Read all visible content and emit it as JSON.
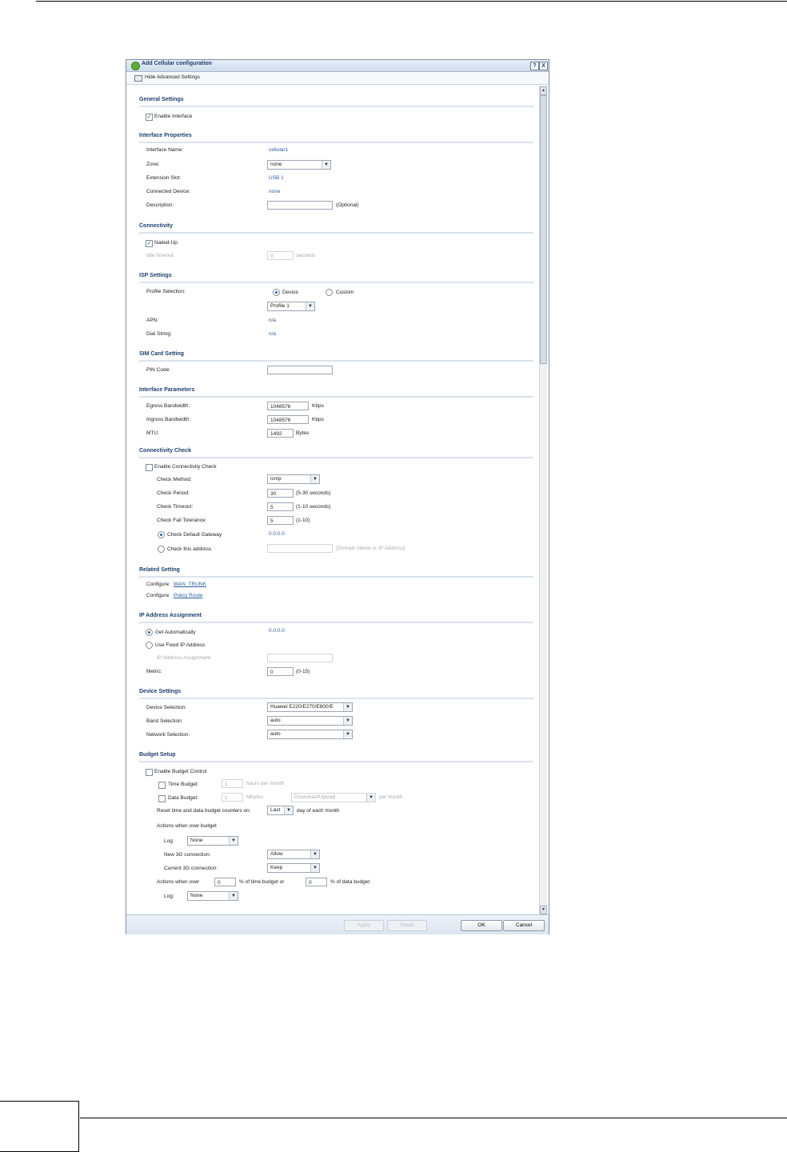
{
  "dialog": {
    "title": "Add Cellular configuration",
    "help_label": "?",
    "close_label": "X",
    "advanced_label": "Hide Advanced Settings"
  },
  "general": {
    "heading": "General Settings",
    "enable_interface": "Enable Interface"
  },
  "iface_props": {
    "heading": "Interface Properties",
    "name_label": "Interface Name:",
    "name_value": "cellular1",
    "zone_label": "Zone:",
    "zone_value": "none",
    "slot_label": "Extension Slot:",
    "slot_value": "USB 1",
    "device_label": "Connected Device:",
    "device_value": "none",
    "desc_label": "Description:",
    "desc_value": "",
    "desc_hint": "(Optional)"
  },
  "connectivity": {
    "heading": "Connectivity",
    "nailed_up": "Nailed-Up",
    "idle_label": "Idle timeout:",
    "idle_value": "0",
    "idle_unit": "seconds"
  },
  "isp": {
    "heading": "ISP Settings",
    "profile_label": "Profile Selection:",
    "opt_device": "Device",
    "opt_custom": "Custom",
    "profile_value": "Profile 1",
    "apn_label": "APN:",
    "apn_value": "n/a",
    "dial_label": "Dial String:",
    "dial_value": "n/a"
  },
  "sim": {
    "heading": "SIM Card Setting",
    "pin_label": "PIN Code:",
    "pin_value": ""
  },
  "params": {
    "heading": "Interface Parameters",
    "egress_label": "Egress Bandwidth:",
    "egress_value": "1048576",
    "egress_unit": "Kbps",
    "ingress_label": "Ingress Bandwidth:",
    "ingress_value": "1048576",
    "ingress_unit": "Kbps",
    "mtu_label": "MTU:",
    "mtu_value": "1492",
    "mtu_unit": "Bytes"
  },
  "check": {
    "heading": "Connectivity Check",
    "enable": "Enable Connectivity Check",
    "method_label": "Check Method:",
    "method_value": "icmp",
    "period_label": "Check Period:",
    "period_value": "30",
    "period_hint": "(5-30 seconds)",
    "timeout_label": "Check Timeout:",
    "timeout_value": "5",
    "timeout_hint": "(1-10 seconds)",
    "fail_label": "Check Fail Tolerance:",
    "fail_value": "5",
    "fail_hint": "(1-10)",
    "gw_label": "Check Default Gateway",
    "gw_value": "0.0.0.0",
    "addr_label": "Check this address",
    "addr_value": "",
    "addr_hint": "(Domain Name or IP Address)"
  },
  "related": {
    "heading": "Related Setting",
    "configure": "Configure",
    "wan_trunk": "WAN_TRUNK",
    "policy_route": "Policy Route"
  },
  "ip": {
    "heading": "IP Address Assignment",
    "auto": "Get Automatically",
    "auto_value": "0.0.0.0",
    "fixed": "Use Fixed IP Address",
    "assign_label": "IP Address Assignment:",
    "assign_value": "",
    "metric_label": "Metric:",
    "metric_value": "0",
    "metric_hint": "(0-15)"
  },
  "device": {
    "heading": "Device Settings",
    "device_label": "Device Selection:",
    "device_value": "Huawei E220/E270/E800/E",
    "band_label": "Band Selection:",
    "band_value": "auto",
    "network_label": "Network Selection:",
    "network_value": "auto"
  },
  "budget": {
    "heading": "Budget Setup",
    "enable": "Enable Budget Control",
    "time_label": "Time Budget:",
    "time_value": "1",
    "time_unit": "hours per month",
    "data_label": "Data Budget:",
    "data_value": "1",
    "data_unit": "Mbytes",
    "data_dir": "Download/Upload",
    "data_per": "per month",
    "reset_label": "Reset time and data budget counters on:",
    "reset_value": "Last",
    "reset_suffix": "day of each month",
    "over_heading": "Actions when over budget",
    "log_label": "Log:",
    "log_value": "None",
    "new_label": "New 3G connection:",
    "new_value": "Allow",
    "cur_label": "Current 3G connection:",
    "cur_value": "Keep",
    "over_label": "Actions when over",
    "over_time_value": "0",
    "over_time_suffix": "% of time budget or",
    "over_data_value": "0",
    "over_data_suffix": "% of data budget",
    "log2_label": "Log:",
    "log2_value": "None"
  },
  "footer": {
    "apply": "Apply",
    "reset": "Reset",
    "ok": "OK",
    "cancel": "Cancel"
  }
}
